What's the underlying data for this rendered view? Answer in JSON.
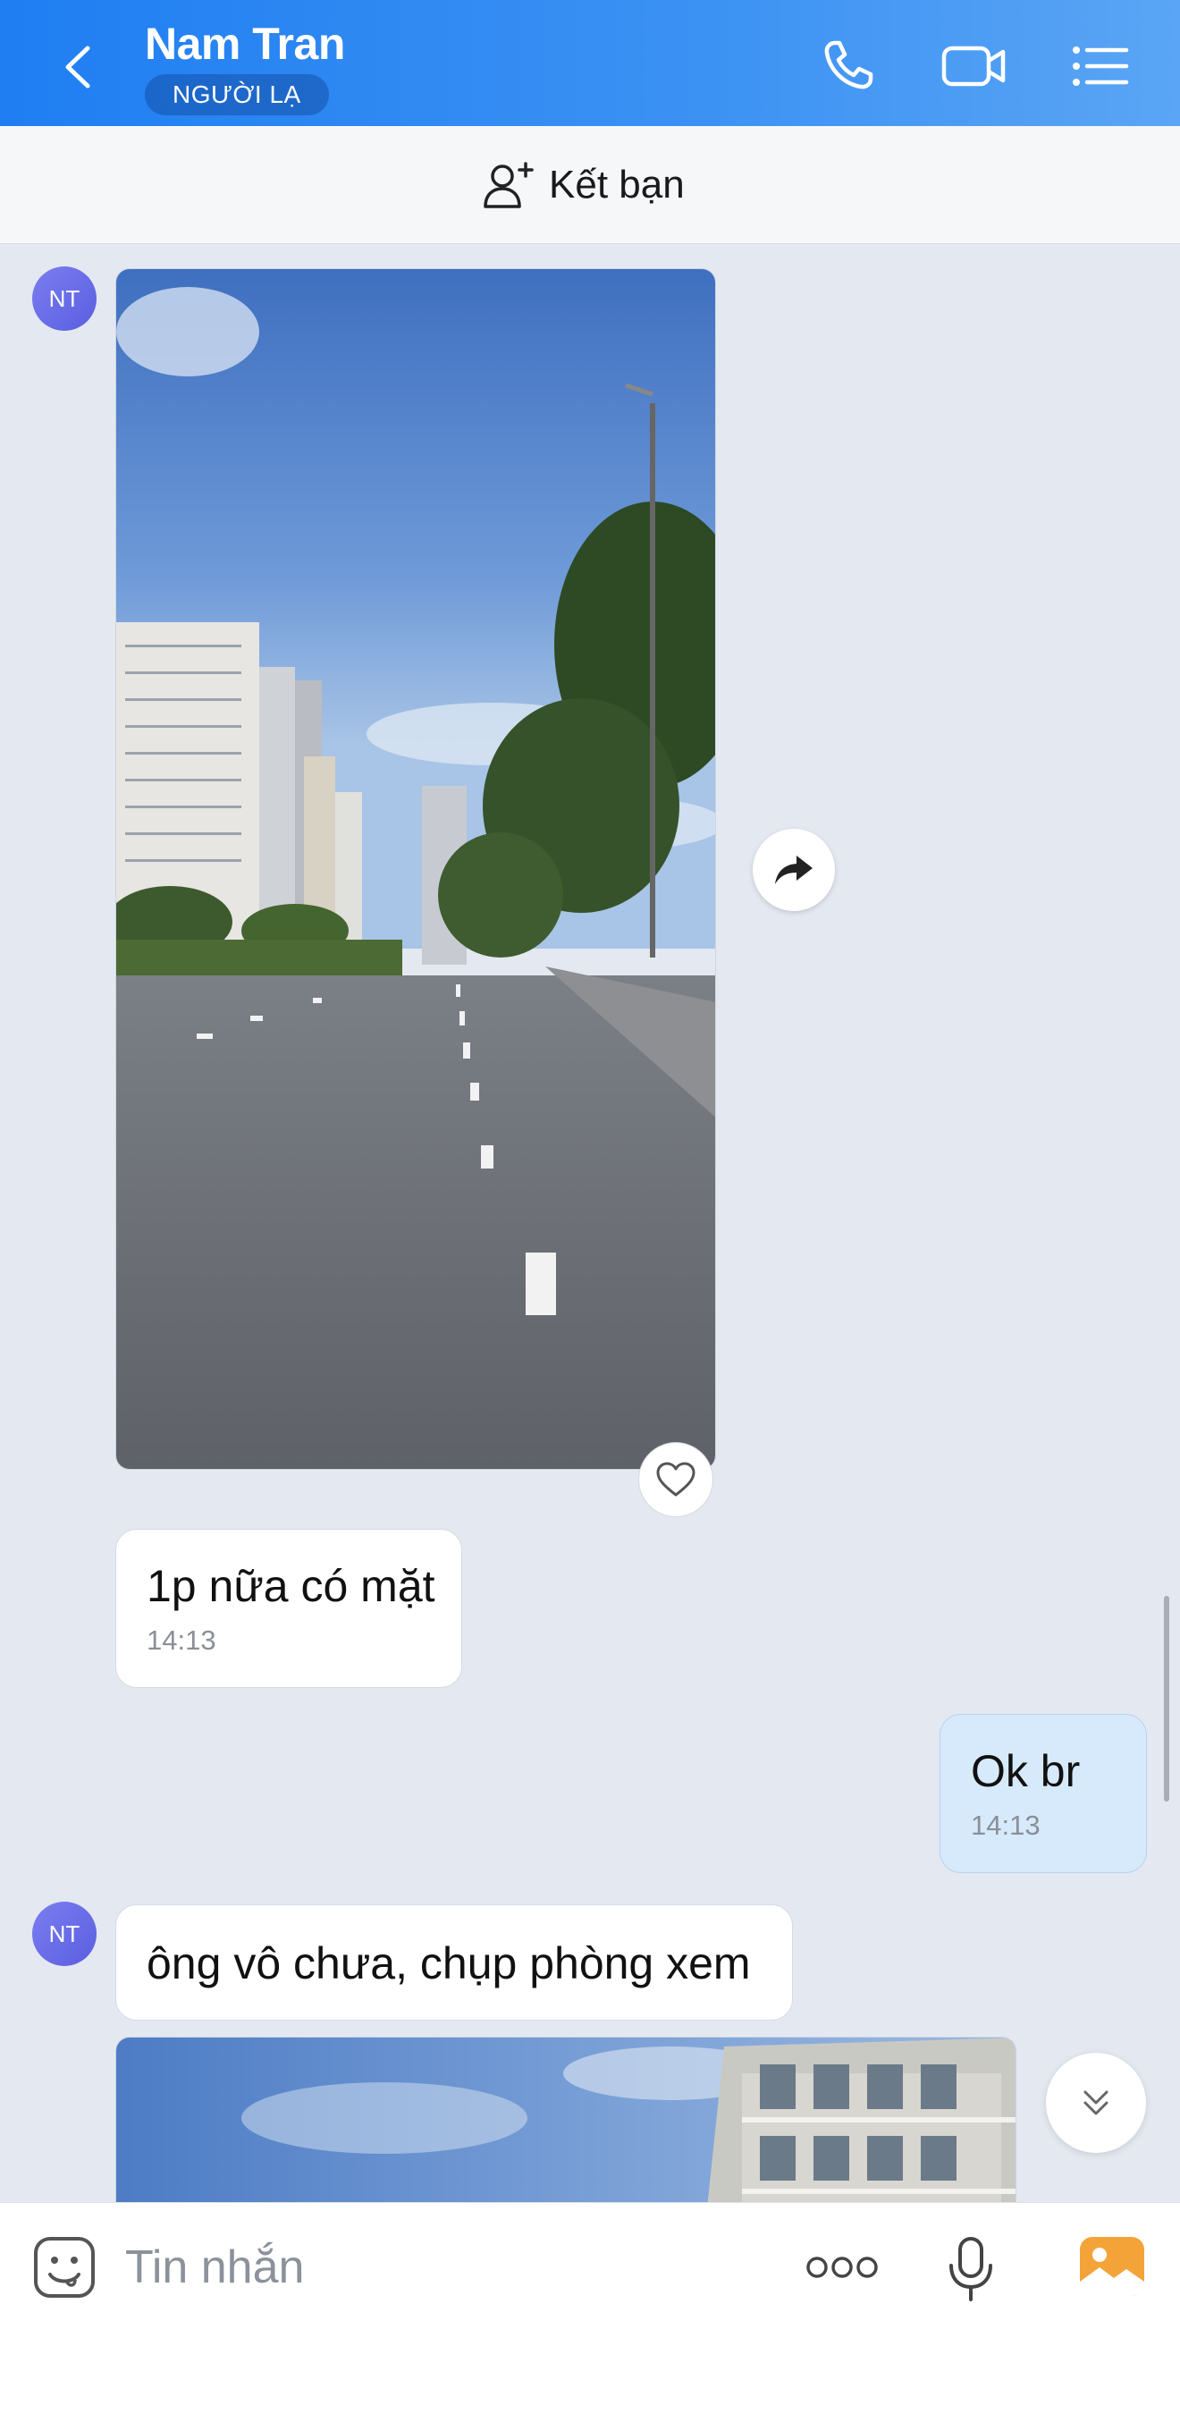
{
  "header": {
    "title": "Nam Tran",
    "badge": "NGƯỜI LẠ",
    "accent_color": "#1f7ef2",
    "icons": [
      "back-icon",
      "phone-icon",
      "video-call-icon",
      "menu-list-icon"
    ]
  },
  "friend_bar": {
    "label": "Kết bạn",
    "icon": "add-friend-icon"
  },
  "conversation": {
    "contact_initials": "NT",
    "messages": [
      {
        "type": "image",
        "sender": "contact",
        "description_icon": "street-photo"
      },
      {
        "type": "text",
        "sender": "contact",
        "text": "1p nữa có mặt",
        "time": "14:13"
      },
      {
        "type": "text",
        "sender": "me",
        "text": "Ok br",
        "time": "14:13"
      },
      {
        "type": "text",
        "sender": "contact",
        "text": "ông vô chưa, chụp phòng xem"
      },
      {
        "type": "image",
        "sender": "contact",
        "description_icon": "building-photo"
      }
    ]
  },
  "composer": {
    "placeholder": "Tin nhắn",
    "icons": [
      "sticker-icon",
      "more-icon",
      "mic-icon",
      "gallery-icon"
    ]
  }
}
